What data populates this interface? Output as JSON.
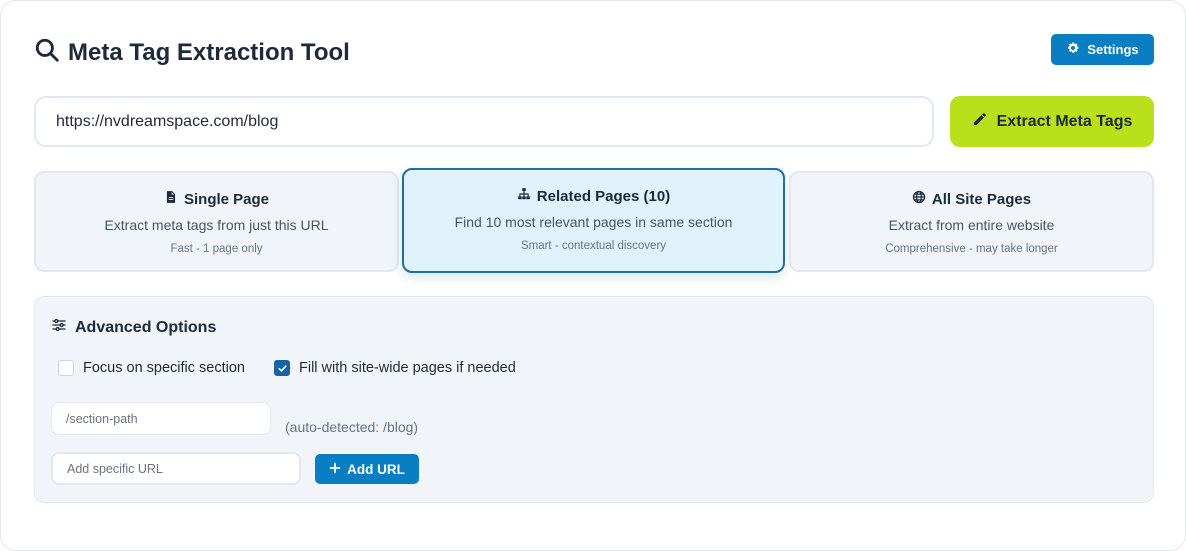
{
  "header": {
    "title": "Meta Tag Extraction Tool",
    "title_icon": "search-icon",
    "settings_label": "Settings",
    "settings_icon": "gear-icon"
  },
  "url_bar": {
    "value": "https://nvdreamspace.com/blog",
    "extract_label": "Extract Meta Tags",
    "extract_icon": "pencil-icon"
  },
  "modes": [
    {
      "title": "Single Page",
      "icon": "file-icon",
      "description": "Extract meta tags from just this URL",
      "note": "Fast - 1 page only",
      "active": false
    },
    {
      "title": "Related Pages (10)",
      "icon": "sitemap-icon",
      "description": "Find 10 most relevant pages in same section",
      "note": "Smart - contextual discovery",
      "active": true
    },
    {
      "title": "All Site Pages",
      "icon": "globe-icon",
      "description": "Extract from entire website",
      "note": "Comprehensive - may take longer",
      "active": false
    }
  ],
  "advanced": {
    "heading": "Advanced Options",
    "heading_icon": "sliders-icon",
    "focus_section_label": "Focus on specific section",
    "focus_section_checked": false,
    "fill_sitewide_label": "Fill with site-wide pages if needed",
    "fill_sitewide_checked": true,
    "section_path_placeholder": "/section-path",
    "auto_detected_hint": "(auto-detected: /blog)",
    "add_url_placeholder": "Add specific URL",
    "add_url_label": "Add URL",
    "add_url_icon": "plus-icon"
  },
  "colors": {
    "primary": "#0a7ec2",
    "accent_lime": "#b9e01a",
    "active_card_bg": "#e0f3fc",
    "active_card_border": "#1f6f9e"
  }
}
